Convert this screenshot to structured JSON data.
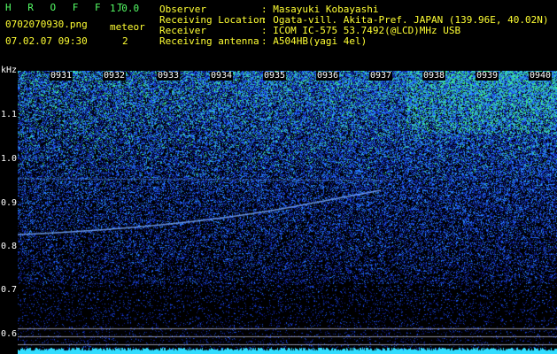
{
  "app": {
    "name": "H R O F F T",
    "version": "1.0.0",
    "filename": "0702070930.png",
    "datetime": "07.02.07 09:30"
  },
  "meteor": {
    "label": "meteor",
    "count": "2"
  },
  "info": [
    {
      "label": "Observer",
      "value": ": Masayuki Kobayashi"
    },
    {
      "label": "Receiving Location",
      "value": ": Ogata-vill. Akita-Pref. JAPAN (139.96E, 40.02N)"
    },
    {
      "label": "Receiver",
      "value": ": ICOM IC-575 53.7492(@LCD)MHz USB"
    },
    {
      "label": "Receiving antenna",
      "value": ": A504HB(yagi 4el)"
    }
  ],
  "axis": {
    "y_unit": "kHz",
    "y_ticks": [
      "1.1",
      "1.0",
      "0.9",
      "0.8",
      "0.7",
      "0.6"
    ],
    "x_ticks": [
      "0931",
      "0932",
      "0933",
      "0934",
      "0935",
      "0936",
      "0937",
      "0938",
      "0939",
      "0940"
    ]
  },
  "colors": {
    "background": "#000000",
    "header_label": "#ffff33",
    "version": "#55ff66",
    "low_intensity": "#0a1a8c",
    "mid_intensity": "#2a60ff",
    "high_intensity": "#40ffa0"
  }
}
